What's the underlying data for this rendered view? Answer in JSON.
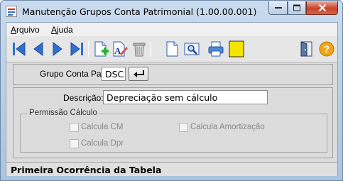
{
  "window": {
    "title": "Manutenção Grupos Conta Patrimonial (1.00.00.001)",
    "icon": "app-window-icon"
  },
  "menu": {
    "items": [
      {
        "label": "Arquivo",
        "accel": "A"
      },
      {
        "label": "Ajuda",
        "accel": "A"
      }
    ]
  },
  "toolbar": {
    "buttons": [
      {
        "icon": "first-record-icon"
      },
      {
        "icon": "previous-record-icon"
      },
      {
        "icon": "next-record-icon"
      },
      {
        "icon": "last-record-icon"
      },
      {
        "icon": "new-record-icon"
      },
      {
        "icon": "edit-record-icon"
      },
      {
        "icon": "delete-record-icon"
      },
      {
        "icon": "blank-document-icon"
      },
      {
        "icon": "preview-icon"
      },
      {
        "icon": "print-icon"
      },
      {
        "icon": "yellow-note-icon"
      },
      {
        "icon": "exit-door-icon"
      },
      {
        "icon": "help-icon"
      }
    ]
  },
  "form": {
    "grupo_label": "Grupo Conta Pat:",
    "grupo_value": "DSC",
    "descricao_label": "Descrição:",
    "descricao_value": "Depreciação sem cálculo",
    "permissao": {
      "title": "Permissão Cálculo",
      "options": [
        {
          "label": "Calcula CM",
          "checked": false
        },
        {
          "label": "Calcula Amortização",
          "checked": false
        },
        {
          "label": "Calcula Dpr",
          "checked": false
        }
      ]
    }
  },
  "status": {
    "text": "Primeira Ocorrência da Tabela"
  },
  "colors": {
    "nav_blue": "#2f6fd0",
    "note_yellow": "#f5e400",
    "help_orange": "#f2a516",
    "close_red": "#c7442c"
  }
}
